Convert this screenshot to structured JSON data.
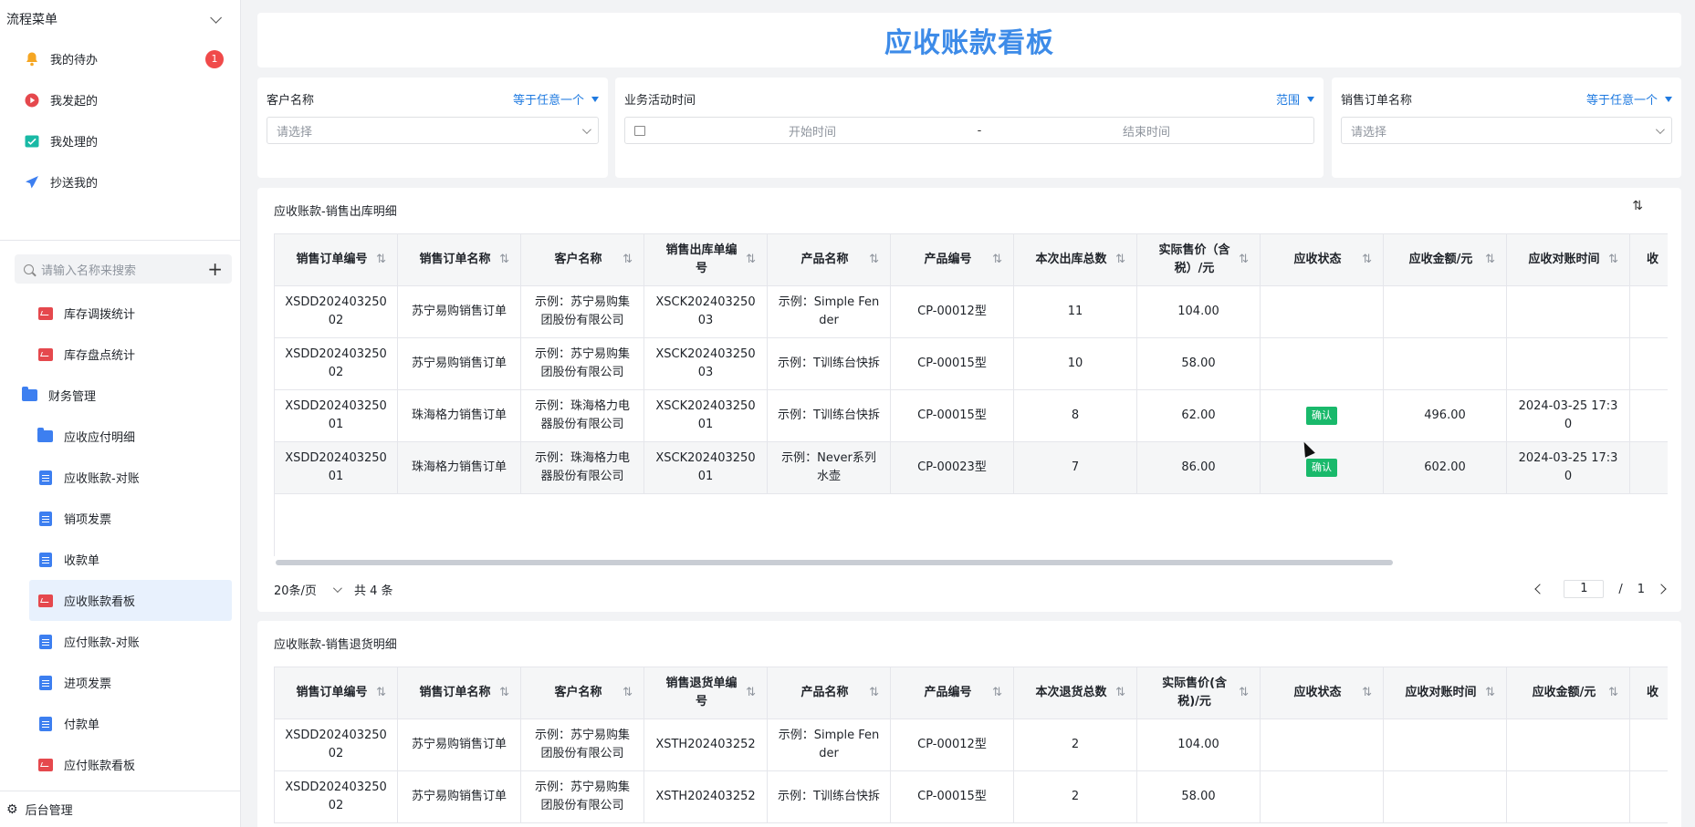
{
  "sidebar": {
    "header": "流程菜单",
    "flow_items": [
      {
        "label": "我的待办",
        "badge": "1"
      },
      {
        "label": "我发起的"
      },
      {
        "label": "我处理的"
      },
      {
        "label": "抄送我的"
      }
    ],
    "search_placeholder": "请输入名称来搜索",
    "menu_items": [
      {
        "label": "库存调拨统计"
      },
      {
        "label": "库存盘点统计"
      },
      {
        "label": "财务管理"
      },
      {
        "label": "应收应付明细"
      },
      {
        "label": "应收账款-对账"
      },
      {
        "label": "销项发票"
      },
      {
        "label": "收款单"
      },
      {
        "label": "应收账款看板"
      },
      {
        "label": "应付账款-对账"
      },
      {
        "label": "进项发票"
      },
      {
        "label": "付款单"
      },
      {
        "label": "应付账款看板"
      }
    ],
    "footer": "后台管理"
  },
  "page": {
    "title": "应收账款看板"
  },
  "filters": [
    {
      "label": "客户名称",
      "operator": "等于任意一个",
      "placeholder": "请选择"
    },
    {
      "label": "业务活动时间",
      "operator": "范围",
      "start": "开始时间",
      "separator": "-",
      "end": "结束时间"
    },
    {
      "label": "销售订单名称",
      "operator": "等于任意一个",
      "placeholder": "请选择"
    }
  ],
  "table1": {
    "title": "应收账款-销售出库明细",
    "columns": [
      "销售订单编号",
      "销售订单名称",
      "客户名称",
      "销售出库单编号",
      "产品名称",
      "产品编号",
      "本次出库总数",
      "实际售价（含税）/元",
      "应收状态",
      "应收金额/元",
      "应收对账时间",
      "收"
    ],
    "rows": [
      [
        "XSDD20240325002",
        "苏宁易购销售订单",
        "示例：苏宁易购集团股份有限公司",
        "XSCK20240325003",
        "示例：Simple Fender",
        "CP-00012型",
        "11",
        "104.00",
        "",
        "",
        ""
      ],
      [
        "XSDD20240325002",
        "苏宁易购销售订单",
        "示例：苏宁易购集团股份有限公司",
        "XSCK20240325003",
        "示例：T训练台快拆",
        "CP-00015型",
        "10",
        "58.00",
        "",
        "",
        ""
      ],
      [
        "XSDD20240325001",
        "珠海格力销售订单",
        "示例：珠海格力电器股份有限公司",
        "XSCK20240325001",
        "示例：T训练台快拆",
        "CP-00015型",
        "8",
        "62.00",
        "确认",
        "496.00",
        "2024-03-25 17:30"
      ],
      [
        "XSDD20240325001",
        "珠海格力销售订单",
        "示例：珠海格力电器股份有限公司",
        "XSCK20240325001",
        "示例：Never系列水壶",
        "CP-00023型",
        "7",
        "86.00",
        "确认",
        "602.00",
        "2024-03-25 17:30"
      ]
    ],
    "page_size": "20条/页",
    "total": "共 4 条",
    "current_page": "1",
    "page_sep": "/",
    "total_pages": "1"
  },
  "table2": {
    "title": "应收账款-销售退货明细",
    "columns": [
      "销售订单编号",
      "销售订单名称",
      "客户名称",
      "销售退货单编号",
      "产品名称",
      "产品编号",
      "本次退货总数",
      "实际售价(含税)/元",
      "应收状态",
      "应收对账时间",
      "应收金额/元",
      "收"
    ],
    "rows": [
      [
        "XSDD20240325002",
        "苏宁易购销售订单",
        "示例：苏宁易购集团股份有限公司",
        "XSTH202403252",
        "示例：Simple Fender",
        "CP-00012型",
        "2",
        "104.00",
        "",
        "",
        ""
      ],
      [
        "XSDD20240325002",
        "苏宁易购销售订单",
        "示例：苏宁易购集团股份有限公司",
        "XSTH202403252",
        "示例：T训练台快拆",
        "CP-00015型",
        "2",
        "58.00",
        "",
        "",
        ""
      ]
    ]
  },
  "colors": {
    "accent": "#3d8be8",
    "link": "#1f7ae0",
    "confirm_tag": "#19b96b",
    "badge": "#f04a4a"
  }
}
